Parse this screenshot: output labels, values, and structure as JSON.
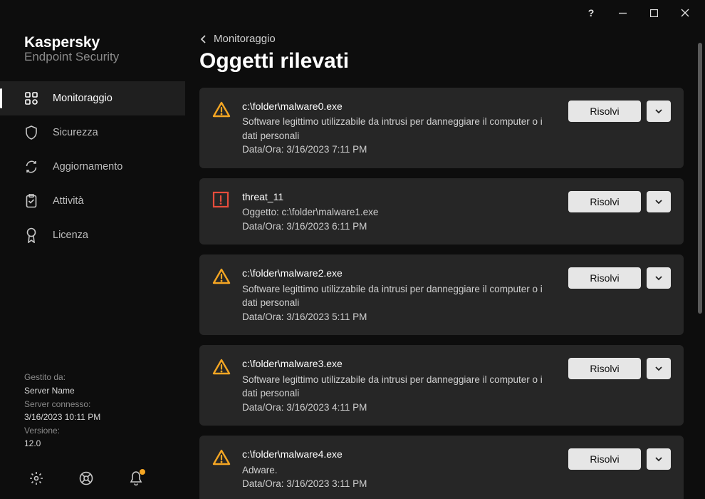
{
  "brand": {
    "line1": "Kaspersky",
    "line2": "Endpoint Security"
  },
  "nav": {
    "monitoring": "Monitoraggio",
    "security": "Sicurezza",
    "update": "Aggiornamento",
    "tasks": "Attività",
    "license": "Licenza"
  },
  "footer_meta": {
    "managed_label": "Gestito da:",
    "managed_value": "Server Name",
    "connected_label": "Server connesso:",
    "connected_value": "3/16/2023 10:11 PM",
    "version_label": "Versione:",
    "version_value": "12.0"
  },
  "breadcrumb": {
    "back_label": "Monitoraggio"
  },
  "page_title": "Oggetti rilevati",
  "resolve_label": "Risolvi",
  "threats": [
    {
      "severity": "warning",
      "title": "c:\\folder\\malware0.exe",
      "desc": "Software legittimo utilizzabile da intrusi per danneggiare il computer o i dati personali",
      "datetime": "Data/Ora: 3/16/2023 7:11 PM"
    },
    {
      "severity": "critical",
      "title": "threat_11",
      "desc": "Oggetto: c:\\folder\\malware1.exe",
      "datetime": "Data/Ora: 3/16/2023 6:11 PM"
    },
    {
      "severity": "warning",
      "title": "c:\\folder\\malware2.exe",
      "desc": "Software legittimo utilizzabile da intrusi per danneggiare il computer o i dati personali",
      "datetime": "Data/Ora: 3/16/2023 5:11 PM"
    },
    {
      "severity": "warning",
      "title": "c:\\folder\\malware3.exe",
      "desc": "Software legittimo utilizzabile da intrusi per danneggiare il computer o i dati personali",
      "datetime": "Data/Ora: 3/16/2023 4:11 PM"
    },
    {
      "severity": "warning",
      "title": "c:\\folder\\malware4.exe",
      "desc": "Adware.",
      "datetime": "Data/Ora: 3/16/2023 3:11 PM"
    }
  ]
}
